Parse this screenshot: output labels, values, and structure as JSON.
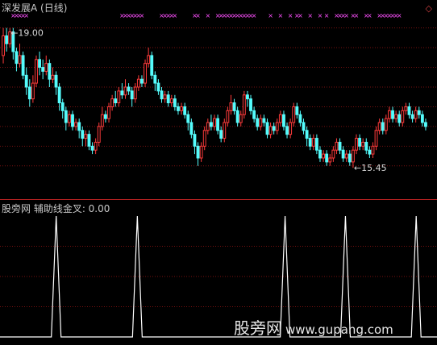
{
  "top_panel": {
    "title": "深发展A (日线)",
    "high_label": "19.00",
    "low_label": "15.45",
    "high_arrow": "←",
    "low_arrow": "←"
  },
  "bottom_panel": {
    "title": "股旁网 辅助线金叉: 0.00"
  },
  "watermark": {
    "brand": "股旁网",
    "url": "www.gupang.com"
  },
  "colors": {
    "background": "#000000",
    "up_candle": "#ff3b3b",
    "down_candle": "#54fcfc",
    "signal_marker": "#ff50ff",
    "grid": "#7a1010",
    "indicator_line": "#ffffff"
  },
  "chart_data": [
    {
      "type": "candlestick",
      "title": "深发展A (日线)",
      "ylim": [
        14.8,
        19.3
      ],
      "grid": true,
      "annotations": [
        {
          "text": "19.00",
          "at_index": 2,
          "value": 19.0
        },
        {
          "text": "15.45",
          "at_index": 106,
          "value": 15.45
        }
      ],
      "candles": [
        [
          18.3,
          18.8,
          19.0,
          18.1
        ],
        [
          18.8,
          18.6,
          19.0,
          18.4
        ],
        [
          18.6,
          18.9,
          19.0,
          18.5
        ],
        [
          18.9,
          18.4,
          19.0,
          18.2
        ],
        [
          18.4,
          18.1,
          18.5,
          17.9
        ],
        [
          18.1,
          18.3,
          18.6,
          18.0
        ],
        [
          18.3,
          17.8,
          18.4,
          17.7
        ],
        [
          17.8,
          17.5,
          18.0,
          17.3
        ],
        [
          17.5,
          17.2,
          17.7,
          17.0
        ],
        [
          17.2,
          17.6,
          17.8,
          17.1
        ],
        [
          17.6,
          18.2,
          18.3,
          17.5
        ],
        [
          18.2,
          18.0,
          18.4,
          17.8
        ],
        [
          18.0,
          17.9,
          18.2,
          17.7
        ],
        [
          17.9,
          18.1,
          18.3,
          17.8
        ],
        [
          18.1,
          17.7,
          18.2,
          17.5
        ],
        [
          17.7,
          17.8,
          18.0,
          17.6
        ],
        [
          17.8,
          17.5,
          17.9,
          17.3
        ],
        [
          17.5,
          17.1,
          17.6,
          16.9
        ],
        [
          17.1,
          16.9,
          17.2,
          16.7
        ],
        [
          16.9,
          16.6,
          17.0,
          16.4
        ],
        [
          16.6,
          16.8,
          16.9,
          16.5
        ],
        [
          16.8,
          16.5,
          16.9,
          16.4
        ],
        [
          16.5,
          16.6,
          16.7,
          16.4
        ],
        [
          16.6,
          16.4,
          16.7,
          16.2
        ],
        [
          16.4,
          16.2,
          16.5,
          16.0
        ],
        [
          16.2,
          16.3,
          16.4,
          16.0
        ],
        [
          16.3,
          16.0,
          16.4,
          15.9
        ],
        [
          16.0,
          15.9,
          16.1,
          15.8
        ],
        [
          15.9,
          16.1,
          16.2,
          15.8
        ],
        [
          16.1,
          16.5,
          16.6,
          16.0
        ],
        [
          16.5,
          16.8,
          17.0,
          16.4
        ],
        [
          16.8,
          16.7,
          16.9,
          16.6
        ],
        [
          16.7,
          17.0,
          17.1,
          16.6
        ],
        [
          17.0,
          17.2,
          17.3,
          16.9
        ],
        [
          17.2,
          17.1,
          17.4,
          17.0
        ],
        [
          17.1,
          17.4,
          17.5,
          17.0
        ],
        [
          17.4,
          17.3,
          17.6,
          17.2
        ],
        [
          17.3,
          17.5,
          17.7,
          17.2
        ],
        [
          17.5,
          17.4,
          17.6,
          17.3
        ],
        [
          17.4,
          17.2,
          17.5,
          17.0
        ],
        [
          17.2,
          17.5,
          17.6,
          17.1
        ],
        [
          17.5,
          17.7,
          17.8,
          17.4
        ],
        [
          17.7,
          17.6,
          17.8,
          17.5
        ],
        [
          17.6,
          18.1,
          18.2,
          17.5
        ],
        [
          18.1,
          18.3,
          18.5,
          18.0
        ],
        [
          18.3,
          17.8,
          18.4,
          17.7
        ],
        [
          17.8,
          17.6,
          17.9,
          17.4
        ],
        [
          17.6,
          17.4,
          17.7,
          17.3
        ],
        [
          17.4,
          17.2,
          17.5,
          17.1
        ],
        [
          17.2,
          17.3,
          17.4,
          17.1
        ],
        [
          17.3,
          17.1,
          17.4,
          17.0
        ],
        [
          17.1,
          17.2,
          17.3,
          17.0
        ],
        [
          17.2,
          17.0,
          17.3,
          16.9
        ],
        [
          17.0,
          16.9,
          17.1,
          16.8
        ],
        [
          16.9,
          17.0,
          17.1,
          16.8
        ],
        [
          17.0,
          16.8,
          17.1,
          16.7
        ],
        [
          16.8,
          16.6,
          16.9,
          16.4
        ],
        [
          16.6,
          16.3,
          16.7,
          16.2
        ],
        [
          16.3,
          16.0,
          16.4,
          15.8
        ],
        [
          16.0,
          15.7,
          16.1,
          15.5
        ],
        [
          15.7,
          16.0,
          16.1,
          15.6
        ],
        [
          16.0,
          16.4,
          16.5,
          15.9
        ],
        [
          16.4,
          16.6,
          16.7,
          16.3
        ],
        [
          16.6,
          16.5,
          16.8,
          16.4
        ],
        [
          16.5,
          16.7,
          16.8,
          16.4
        ],
        [
          16.7,
          16.4,
          16.8,
          16.3
        ],
        [
          16.4,
          16.2,
          16.5,
          16.1
        ],
        [
          16.2,
          16.6,
          16.7,
          16.1
        ],
        [
          16.6,
          16.9,
          17.0,
          16.5
        ],
        [
          16.9,
          17.1,
          17.3,
          16.8
        ],
        [
          17.1,
          16.9,
          17.2,
          16.8
        ],
        [
          16.9,
          16.6,
          17.0,
          16.5
        ],
        [
          16.6,
          16.8,
          16.9,
          16.5
        ],
        [
          16.8,
          17.3,
          17.4,
          16.7
        ],
        [
          17.3,
          17.2,
          17.4,
          17.0
        ],
        [
          17.2,
          16.9,
          17.3,
          16.8
        ],
        [
          16.9,
          16.7,
          17.0,
          16.6
        ],
        [
          16.7,
          16.5,
          16.8,
          16.4
        ],
        [
          16.5,
          16.7,
          16.8,
          16.4
        ],
        [
          16.7,
          16.6,
          16.8,
          16.5
        ],
        [
          16.6,
          16.3,
          16.7,
          16.2
        ],
        [
          16.3,
          16.5,
          16.6,
          16.2
        ],
        [
          16.5,
          16.4,
          16.6,
          16.3
        ],
        [
          16.4,
          16.6,
          16.7,
          16.3
        ],
        [
          16.6,
          16.8,
          16.9,
          16.5
        ],
        [
          16.8,
          16.5,
          16.9,
          16.4
        ],
        [
          16.5,
          16.3,
          16.6,
          16.2
        ],
        [
          16.3,
          16.6,
          16.7,
          16.2
        ],
        [
          16.6,
          17.0,
          17.1,
          16.5
        ],
        [
          17.0,
          16.8,
          17.1,
          16.7
        ],
        [
          16.8,
          16.6,
          16.9,
          16.5
        ],
        [
          16.6,
          16.4,
          16.7,
          16.3
        ],
        [
          16.4,
          16.2,
          16.5,
          16.0
        ],
        [
          16.2,
          16.0,
          16.3,
          15.9
        ],
        [
          16.0,
          16.2,
          16.3,
          15.9
        ],
        [
          16.2,
          15.9,
          16.3,
          15.8
        ],
        [
          15.9,
          15.7,
          16.0,
          15.6
        ],
        [
          15.7,
          15.8,
          15.9,
          15.6
        ],
        [
          15.8,
          15.6,
          15.9,
          15.5
        ],
        [
          15.6,
          15.7,
          15.8,
          15.5
        ],
        [
          15.7,
          15.9,
          16.0,
          15.6
        ],
        [
          15.9,
          16.1,
          16.2,
          15.8
        ],
        [
          16.1,
          15.9,
          16.2,
          15.8
        ],
        [
          15.9,
          15.7,
          16.0,
          15.6
        ],
        [
          15.7,
          15.8,
          15.9,
          15.6
        ],
        [
          15.8,
          15.6,
          15.9,
          15.5
        ],
        [
          15.6,
          15.9,
          16.0,
          15.45
        ],
        [
          15.9,
          16.2,
          16.3,
          15.8
        ],
        [
          16.2,
          16.0,
          16.3,
          15.9
        ],
        [
          16.0,
          16.1,
          16.2,
          15.9
        ],
        [
          16.1,
          15.9,
          16.2,
          15.8
        ],
        [
          15.9,
          15.8,
          16.0,
          15.7
        ],
        [
          15.8,
          16.0,
          16.1,
          15.7
        ],
        [
          16.0,
          16.4,
          16.5,
          15.9
        ],
        [
          16.4,
          16.6,
          16.7,
          16.3
        ],
        [
          16.6,
          16.4,
          16.7,
          16.3
        ],
        [
          16.4,
          16.7,
          16.8,
          16.3
        ],
        [
          16.7,
          16.9,
          17.0,
          16.6
        ],
        [
          16.9,
          16.7,
          17.0,
          16.6
        ],
        [
          16.7,
          16.8,
          16.9,
          16.6
        ],
        [
          16.8,
          16.6,
          16.9,
          16.5
        ],
        [
          16.6,
          16.9,
          17.0,
          16.5
        ],
        [
          16.9,
          17.0,
          17.1,
          16.8
        ],
        [
          17.0,
          16.8,
          17.1,
          16.7
        ],
        [
          16.8,
          16.7,
          16.9,
          16.6
        ],
        [
          16.7,
          16.9,
          17.0,
          16.6
        ],
        [
          16.9,
          16.8,
          17.0,
          16.7
        ],
        [
          16.8,
          16.6,
          16.9,
          16.5
        ],
        [
          16.6,
          16.5,
          16.7,
          16.4
        ]
      ],
      "signal_marks": [
        3,
        4,
        5,
        6,
        7,
        36,
        37,
        38,
        39,
        40,
        41,
        42,
        48,
        49,
        50,
        51,
        52,
        58,
        59,
        62,
        65,
        66,
        67,
        68,
        69,
        70,
        71,
        72,
        73,
        74,
        75,
        76,
        81,
        84,
        87,
        89,
        90,
        93,
        96,
        98,
        101,
        102,
        103,
        104,
        106,
        107,
        110,
        111,
        114,
        115,
        116,
        117,
        118,
        119,
        120
      ]
    },
    {
      "type": "line",
      "title": "辅助线金叉: 0.00",
      "ylim": [
        0,
        1
      ],
      "series": [
        {
          "values": [
            0,
            0,
            0,
            0,
            0,
            0,
            0,
            0,
            0,
            0,
            0,
            0,
            0,
            0,
            0,
            0,
            0,
            0,
            0,
            0,
            0,
            0,
            0,
            0,
            0,
            0,
            0,
            1,
            0,
            0,
            0,
            0,
            0,
            0,
            0,
            0,
            0,
            0,
            0,
            0,
            0,
            0,
            0,
            0,
            0,
            0,
            0,
            0,
            0,
            0,
            0,
            0,
            0,
            0,
            0,
            0,
            0,
            0,
            0,
            0,
            0,
            0,
            0,
            0,
            0,
            0,
            0,
            0,
            0,
            0,
            0,
            0,
            0,
            0,
            0,
            0,
            0,
            0,
            0,
            0,
            0,
            0,
            0,
            0,
            0,
            0,
            0,
            0,
            0,
            0,
            0,
            0,
            0,
            0,
            0,
            0,
            0,
            0,
            0,
            0,
            0,
            0,
            0,
            0,
            0,
            0,
            0,
            0,
            0,
            0,
            0,
            0,
            0,
            0,
            0,
            0,
            0,
            0,
            0,
            0,
            0,
            0,
            0,
            0,
            0,
            0,
            0,
            0
          ]
        }
      ],
      "spikes_at": [
        27,
        66,
        137,
        166,
        200
      ]
    }
  ]
}
